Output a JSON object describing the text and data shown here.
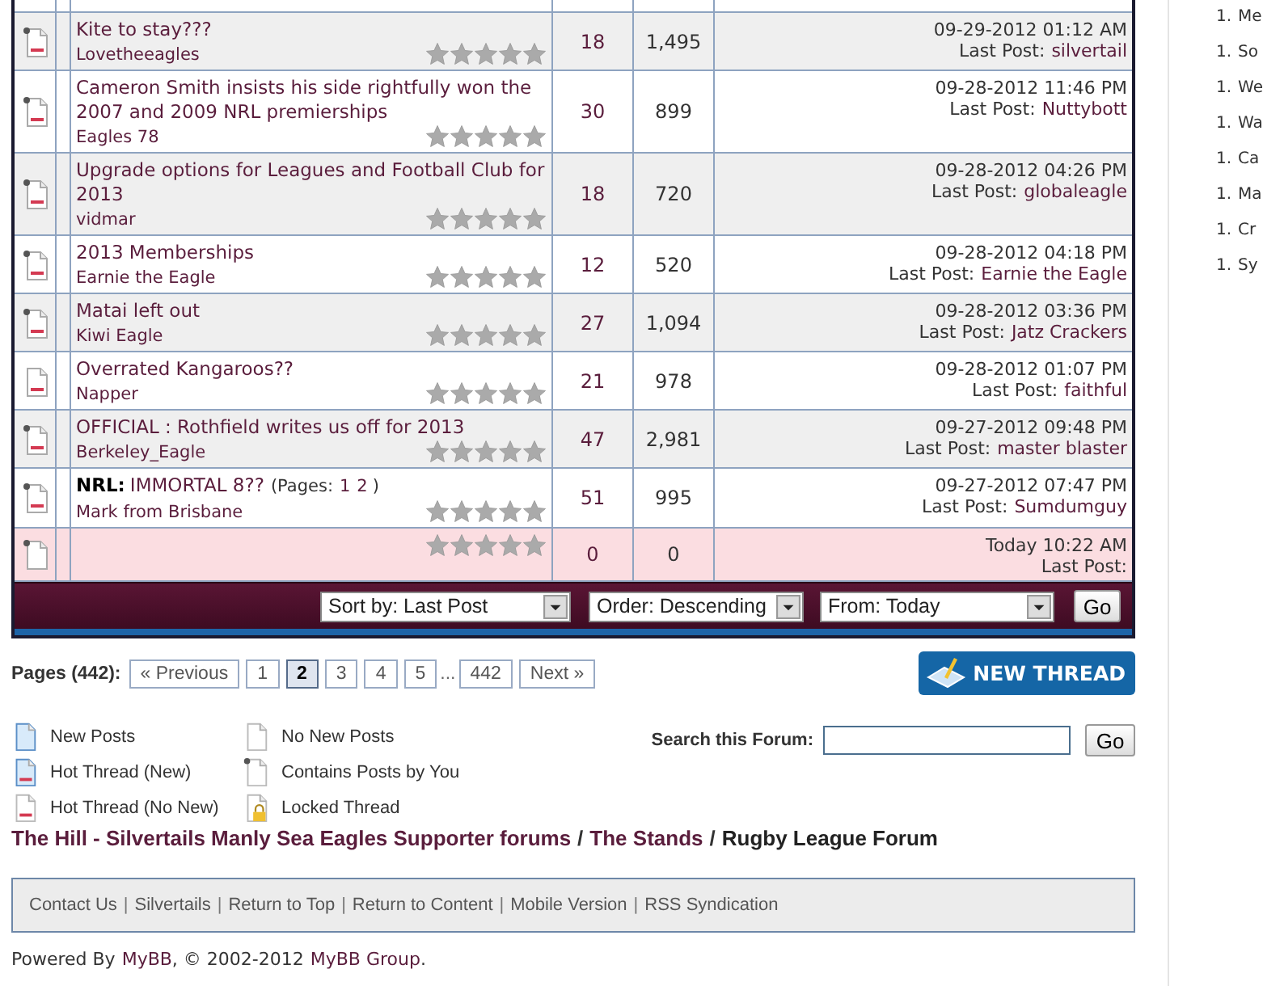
{
  "threads": [
    {
      "title": "Kite to stay???",
      "author": "Lovetheeagles",
      "stars": 0,
      "replies": "18",
      "views": "1,495",
      "date": "09-29-2012 01:12 AM",
      "last_label": "Last Post:",
      "last_user": "silvertail",
      "hot": true,
      "own_posts": true,
      "highlighted": false
    },
    {
      "title": "Cameron Smith insists his side rightfully won the 2007 and 2009 NRL premierships",
      "author": "Eagles 78",
      "stars": 0,
      "replies": "30",
      "views": "899",
      "date": "09-28-2012 11:46 PM",
      "last_label": "Last Post:",
      "last_user": "Nuttybott",
      "hot": true,
      "own_posts": true,
      "highlighted": false
    },
    {
      "title": "Upgrade options for Leagues and Football Club for 2013",
      "author": "vidmar",
      "stars": 0,
      "replies": "18",
      "views": "720",
      "date": "09-28-2012 04:26 PM",
      "last_label": "Last Post:",
      "last_user": "globaleagle",
      "hot": true,
      "own_posts": true,
      "highlighted": false
    },
    {
      "title": "2013 Memberships",
      "author": "Earnie the Eagle",
      "stars": 0,
      "replies": "12",
      "views": "520",
      "date": "09-28-2012 04:18 PM",
      "last_label": "Last Post:",
      "last_user": "Earnie the Eagle",
      "hot": true,
      "own_posts": true,
      "highlighted": false
    },
    {
      "title": "Matai left out",
      "author": "Kiwi Eagle",
      "stars": 0,
      "replies": "27",
      "views": "1,094",
      "date": "09-28-2012 03:36 PM",
      "last_label": "Last Post:",
      "last_user": "Jatz Crackers",
      "hot": true,
      "own_posts": true,
      "highlighted": false
    },
    {
      "title": "Overrated Kangaroos??",
      "author": "Napper",
      "stars": 0,
      "replies": "21",
      "views": "978",
      "date": "09-28-2012 01:07 PM",
      "last_label": "Last Post:",
      "last_user": "faithful",
      "hot": true,
      "own_posts": false,
      "highlighted": false
    },
    {
      "title": "OFFICIAL : Rothfield writes us off for 2013",
      "author": "Berkeley_Eagle",
      "stars": 0,
      "replies": "47",
      "views": "2,981",
      "date": "09-27-2012 09:48 PM",
      "last_label": "Last Post:",
      "last_user": "master blaster",
      "hot": true,
      "own_posts": true,
      "highlighted": false
    },
    {
      "prefix": "NRL:",
      "title": "IMMORTAL 8??",
      "pages": {
        "open": "(Pages:",
        "links": [
          "1",
          "2"
        ],
        "close": ")"
      },
      "author": "Mark from Brisbane",
      "stars": 0,
      "replies": "51",
      "views": "995",
      "date": "09-27-2012 07:47 PM",
      "last_label": "Last Post:",
      "last_user": "Sumdumguy",
      "hot": true,
      "own_posts": true,
      "highlighted": false
    },
    {
      "stars": 0,
      "replies": "0",
      "views": "0",
      "date": "Today 10:22 AM",
      "last_label": "Last Post:",
      "hot": false,
      "own_posts": true,
      "highlighted": true
    }
  ],
  "sort_bar": {
    "selects": [
      "Sort by: Last Post",
      "Order: Descending",
      "From: Today"
    ],
    "button": "Go"
  },
  "pagination": {
    "label": "Pages (442):",
    "items": [
      {
        "kind": "link",
        "label": "« Previous",
        "selected": false
      },
      {
        "kind": "link",
        "label": "1",
        "selected": false
      },
      {
        "kind": "link",
        "label": "2",
        "selected": true
      },
      {
        "kind": "link",
        "label": "3",
        "selected": false
      },
      {
        "kind": "link",
        "label": "4",
        "selected": false
      },
      {
        "kind": "link",
        "label": "5",
        "selected": false
      },
      {
        "kind": "gap",
        "label": "..."
      },
      {
        "kind": "link",
        "label": "442",
        "selected": false
      },
      {
        "kind": "link",
        "label": "Next »",
        "selected": false
      }
    ]
  },
  "new_thread_button": "NEW THREAD",
  "legend": [
    {
      "kind": "new",
      "label": "New Posts"
    },
    {
      "kind": "no_new",
      "label": "No New Posts"
    },
    {
      "kind": "hot_new",
      "label": "Hot Thread (New)"
    },
    {
      "kind": "own",
      "label": "Contains Posts by You"
    },
    {
      "kind": "hot_no_new",
      "label": "Hot Thread (No New)"
    },
    {
      "kind": "locked",
      "label": "Locked Thread"
    }
  ],
  "search": {
    "label": "Search this Forum:",
    "button": "Go"
  },
  "breadcrumb": {
    "separator": "/",
    "items": [
      "The Hill - Silvertails Manly Sea Eagles Supporter forums",
      "The Stands",
      "Rugby League Forum"
    ]
  },
  "footer_links": {
    "separator": "|",
    "links": [
      "Contact Us",
      "Silvertails",
      "Return to Top",
      "Return to Content",
      "Mobile Version",
      "RSS Syndication"
    ]
  },
  "powered_by": {
    "before": "Powered By",
    "link1": "MyBB",
    "middle": ", © 2002-2012",
    "link2": "MyBB Group",
    "after": "."
  },
  "sidebar": [
    {
      "number": "1.",
      "text": "Me"
    },
    {
      "number": "1.",
      "text": "So"
    },
    {
      "number": "1.",
      "text": "We"
    },
    {
      "number": "1.",
      "text": "Wa"
    },
    {
      "number": "1.",
      "text": "Ca"
    },
    {
      "number": "1.",
      "text": "Ma"
    },
    {
      "number": "1.",
      "text": "Cr"
    },
    {
      "number": "1.",
      "text": "Sy"
    }
  ]
}
